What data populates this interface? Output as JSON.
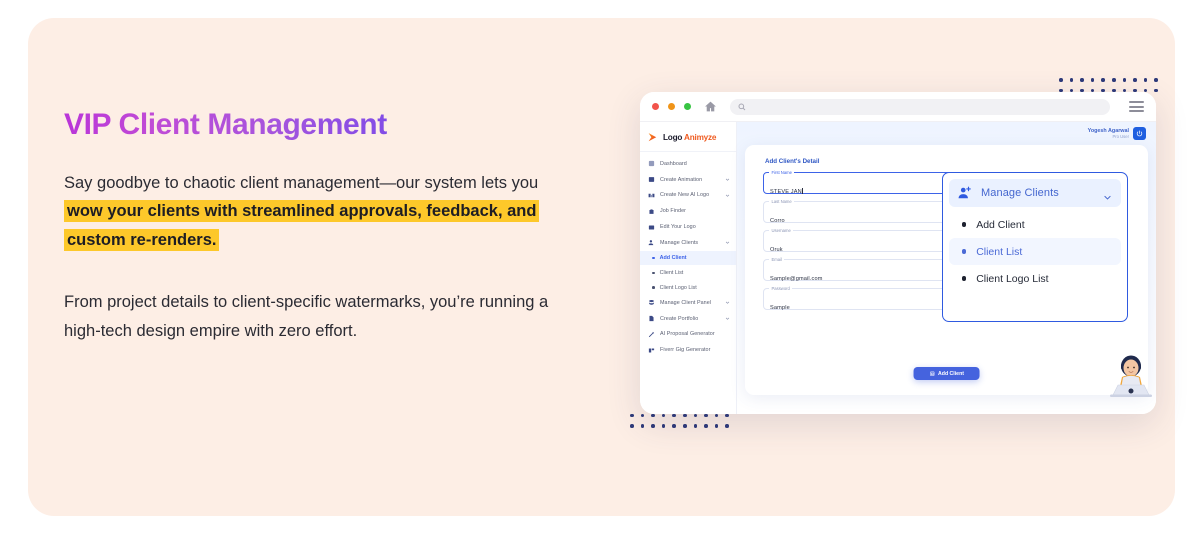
{
  "promo": {
    "headline": "VIP Client Management",
    "paragraph1_pre": "Say goodbye to chaotic client management—our system lets you ",
    "paragraph1_highlight": "wow your clients with streamlined approvals, feedback, and custom re-renders.",
    "paragraph2": "From project details to client-specific watermarks, you’re running a high-tech design empire with zero effort.",
    "highlight_color": "#fdc82a",
    "card_bg": "#fdeee5"
  },
  "browser": {
    "traffic_lights": [
      "red",
      "orange",
      "green"
    ],
    "home_icon": "home-icon",
    "search_icon": "search-icon",
    "url_value": "",
    "menu_icon": "hamburger-icon"
  },
  "app": {
    "brand": {
      "part1": "Logo",
      "part2": "Animyze"
    },
    "user": {
      "name": "Yogesh Agarwal",
      "role": "Pro User"
    },
    "power_icon": "power-icon",
    "sidebar": [
      {
        "label": "Dashboard",
        "icon": "dashboard-icon",
        "chevron": false,
        "type": "item"
      },
      {
        "label": "Create Animation",
        "icon": "animation-icon",
        "chevron": true,
        "type": "item"
      },
      {
        "label": "Create New AI Logo",
        "icon": "ai-logo-icon",
        "chevron": true,
        "type": "item"
      },
      {
        "label": "Job Finder",
        "icon": "briefcase-icon",
        "chevron": false,
        "type": "item"
      },
      {
        "label": "Edit Your Logo",
        "icon": "edit-image-icon",
        "chevron": false,
        "type": "item"
      },
      {
        "label": "Manage Clients",
        "icon": "manage-clients-icon",
        "chevron": true,
        "type": "item"
      },
      {
        "label": "Add Client",
        "type": "sub",
        "active": true
      },
      {
        "label": "Client List",
        "type": "sub",
        "active": false
      },
      {
        "label": "Client Logo List",
        "type": "sub",
        "active": false
      },
      {
        "label": "Manage Client Panel",
        "icon": "panel-icon",
        "chevron": true,
        "type": "item"
      },
      {
        "label": "Create Portfolio",
        "icon": "portfolio-icon",
        "chevron": true,
        "type": "item"
      },
      {
        "label": "AI Proposal Generator",
        "icon": "pen-icon",
        "chevron": false,
        "type": "item"
      },
      {
        "label": "Fiverr Gig Generator",
        "icon": "gig-icon",
        "chevron": false,
        "type": "item"
      }
    ],
    "form": {
      "title": "Add Client's Detail",
      "fields": [
        {
          "label": "First Name",
          "value": "STEVE JAN",
          "focused": true
        },
        {
          "label": "Last Name",
          "value": "Corro",
          "focused": false
        },
        {
          "label": "Username",
          "value": "Oruk",
          "focused": false
        },
        {
          "label": "Email",
          "value": "Sample@gmail.com",
          "focused": false
        },
        {
          "label": "Password",
          "value": "Sample",
          "focused": false
        }
      ],
      "submit_label": "Add Client",
      "submit_icon": "save-icon",
      "submit_color": "#4563de"
    },
    "dropdown": {
      "header_label": "Manage Clients",
      "header_icon": "add-user-icon",
      "chevron_icon": "chevron-down-icon",
      "items": [
        {
          "label": "Add Client",
          "selected": false
        },
        {
          "label": "Client List",
          "selected": true
        },
        {
          "label": "Client Logo List",
          "selected": false
        }
      ]
    }
  }
}
